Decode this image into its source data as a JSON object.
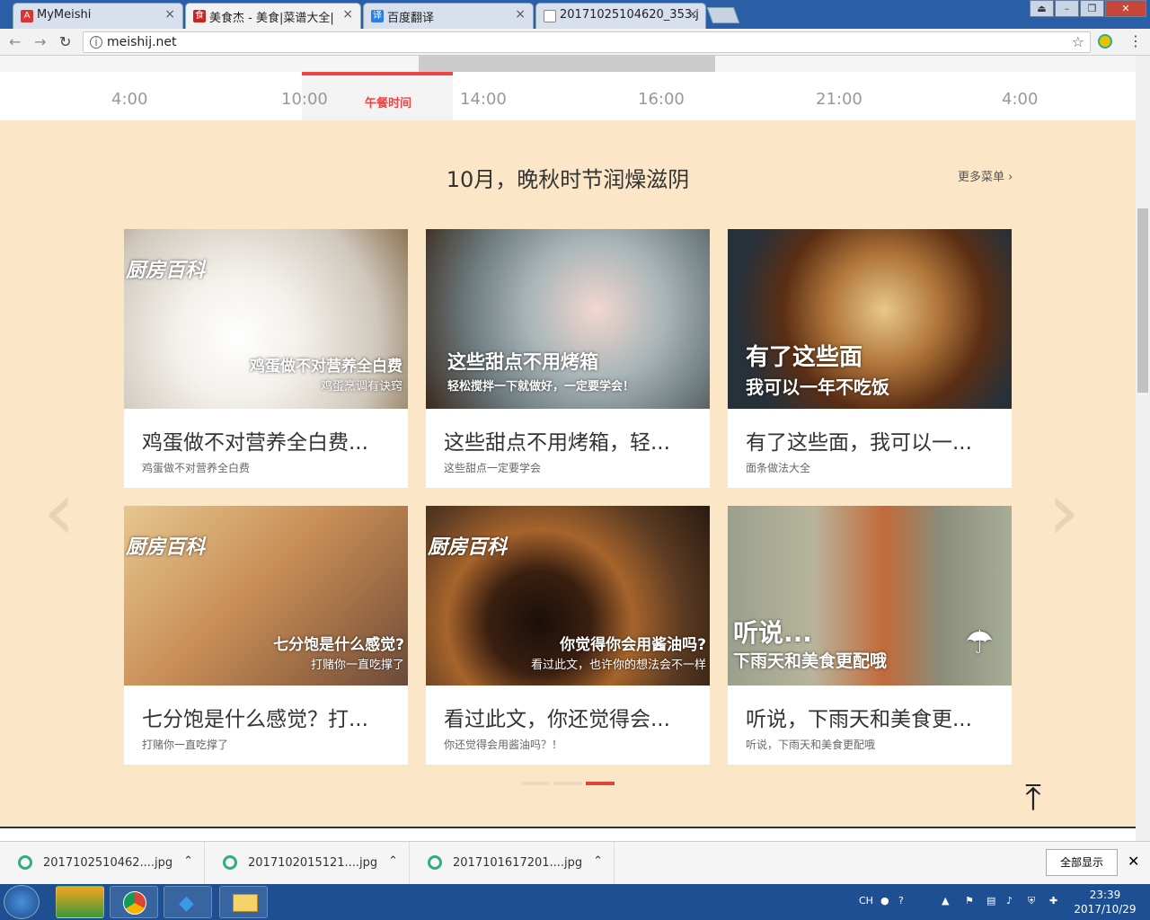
{
  "browser": {
    "tabs": [
      {
        "title": "MyMeishi",
        "favicon": "angular-icon",
        "color": "#d33"
      },
      {
        "title": "美食杰 - 美食|菜谱大全|",
        "favicon": "meishij-icon",
        "color": "#c22"
      },
      {
        "title": "百度翻译",
        "favicon": "translate-icon",
        "color": "#2b7de9"
      },
      {
        "title": "20171025104620_353.j",
        "favicon": "file-icon",
        "color": "#888"
      }
    ],
    "url": "meishij.net"
  },
  "timeline": {
    "ticks": [
      "4:00",
      "10:00",
      "14:00",
      "16:00",
      "21:00",
      "4:00"
    ],
    "current_label": "午餐时间"
  },
  "section": {
    "title": "10月，晚秋时节润燥滋阴",
    "more": "更多菜单 ›"
  },
  "cards": [
    {
      "title": "鸡蛋做不对营养全白费...",
      "sub": "鸡蛋做不对营养全白费",
      "ov1": "鸡蛋做不对营养全白费",
      "ov2": "鸡蛋烹调有诀窍",
      "brand": "厨房百科",
      "bg": "#d8d4cc"
    },
    {
      "title": "这些甜点不用烤箱，轻...",
      "sub": "这些甜点一定要学会",
      "ov1": "这些甜点不用烤箱",
      "ov2": "轻松搅拌一下就做好，一定要学会！",
      "brand": "",
      "bg": "#7f8b8f"
    },
    {
      "title": "有了这些面，我可以一...",
      "sub": "面条做法大全",
      "ov1": "有了这些面",
      "ov2": "我可以一年不吃饭",
      "brand": "",
      "bg": "#4d3a2a"
    },
    {
      "title": "七分饱是什么感觉？打...",
      "sub": "打赌你一直吃撑了",
      "ov1": "七分饱是什么感觉?",
      "ov2": "打赌你一直吃撑了",
      "brand": "厨房百科",
      "bg": "#c9a27a"
    },
    {
      "title": "看过此文，你还觉得会...",
      "sub": "你还觉得会用酱油吗？！",
      "ov1": "你觉得你会用酱油吗?",
      "ov2": "看过此文，也许你的想法会不一样",
      "brand": "厨房百科",
      "bg": "#5a3a22"
    },
    {
      "title": "听说，下雨天和美食更...",
      "sub": "听说，下雨天和美食更配哦",
      "ov1": "听说...",
      "ov2": "下雨天和美食更配哦",
      "brand": "",
      "bg": "#8a8d7a"
    }
  ],
  "downloads": [
    {
      "name": "2017102510462....jpg"
    },
    {
      "name": "2017102015121....jpg"
    },
    {
      "name": "2017101617201....jpg"
    }
  ],
  "download_showall": "全部显示",
  "taskbar": {
    "time": "23:39",
    "date": "2017/10/29",
    "lang": "CH"
  }
}
